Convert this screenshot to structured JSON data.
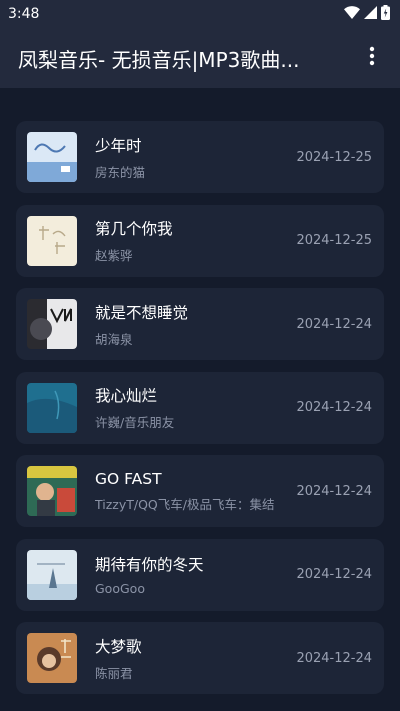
{
  "status": {
    "time": "3:48"
  },
  "appbar": {
    "title": "凤梨音乐- 无损音乐|MP3歌曲..."
  },
  "songs": [
    {
      "title": "少年时",
      "artist": "房东的猫",
      "date": "2024-12-25",
      "cover_color": "#cfe0f4"
    },
    {
      "title": "第几个你我",
      "artist": "赵紫骅",
      "date": "2024-12-25",
      "cover_color": "#f1ebd9"
    },
    {
      "title": "就是不想睡觉",
      "artist": "胡海泉",
      "date": "2024-12-24",
      "cover_color": "#2a2a2e"
    },
    {
      "title": "我心灿烂",
      "artist": "许巍/音乐朋友",
      "date": "2024-12-24",
      "cover_color": "#1f6f8f"
    },
    {
      "title": "GO FAST",
      "artist": "TizzyT/QQ飞车/极品飞车：集结",
      "date": "2024-12-24",
      "cover_color": "#2e6a55"
    },
    {
      "title": "期待有你的冬天",
      "artist": "GooGoo",
      "date": "2024-12-24",
      "cover_color": "#dde8f0"
    },
    {
      "title": "大梦歌",
      "artist": "陈丽君",
      "date": "2024-12-24",
      "cover_color": "#c98a52"
    }
  ],
  "icons": {
    "wifi": "wifi-icon",
    "signal": "signal-icon",
    "battery": "battery-icon",
    "menu": "more-vert-icon"
  }
}
